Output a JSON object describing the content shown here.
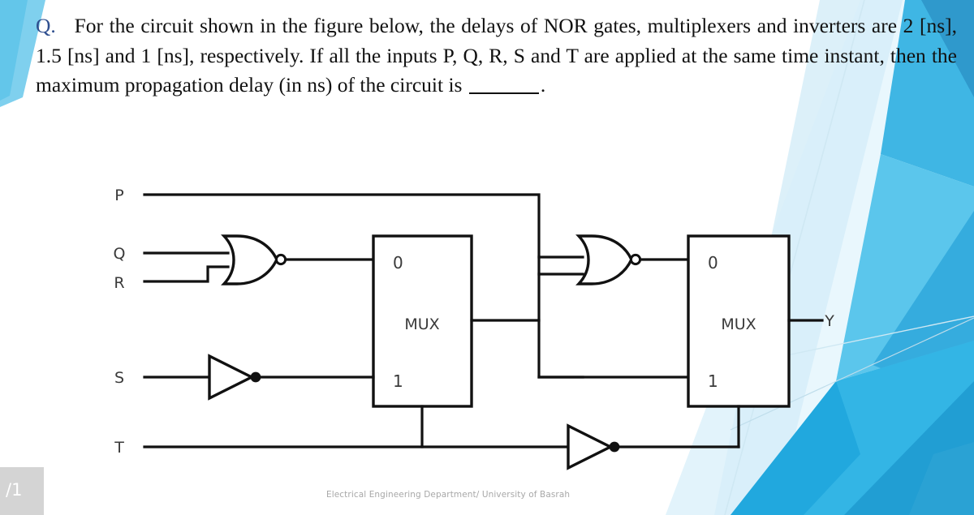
{
  "slide": {
    "question_marker": "Q.",
    "question_text_part1": "For the circuit shown in the figure below, the delays of NOR gates, multiplexers and inverters are 2 [ns], 1.5 [ns] and 1 [ns], respectively. If all the inputs P, Q, R, S and T are applied at the same time instant, then the maximum propagation delay (in ns) of the circuit is",
    "question_blank": "",
    "question_period": ".",
    "footer": "Electrical Engineering Department/ University of Basrah",
    "slide_number": "/1"
  },
  "circuit": {
    "inputs": [
      {
        "label": "P"
      },
      {
        "label": "Q"
      },
      {
        "label": "R"
      },
      {
        "label": "S"
      },
      {
        "label": "T"
      }
    ],
    "output": {
      "label": "Y"
    },
    "mux1": {
      "title": "MUX",
      "input0": "0",
      "input1": "1"
    },
    "mux2": {
      "title": "MUX",
      "input0": "0",
      "input1": "1"
    },
    "gates": [
      {
        "type": "nor-gate",
        "name": "nor-gate-1"
      },
      {
        "type": "nor-gate",
        "name": "nor-gate-2"
      },
      {
        "type": "inverter",
        "name": "inverter-s"
      },
      {
        "type": "inverter",
        "name": "inverter-t"
      }
    ]
  },
  "colors": {
    "accent_blue": "#29ABE2",
    "light_blue": "#BFE4F4",
    "pale_blue": "#E4F3FB",
    "deep_blue": "#1B9BD8",
    "question_mark": "#2F4F8F",
    "ink": "#111111",
    "label_gray": "#3A3A3A",
    "footer_gray": "#A8A8A8",
    "slidenum_bg": "#D4D4D4"
  }
}
